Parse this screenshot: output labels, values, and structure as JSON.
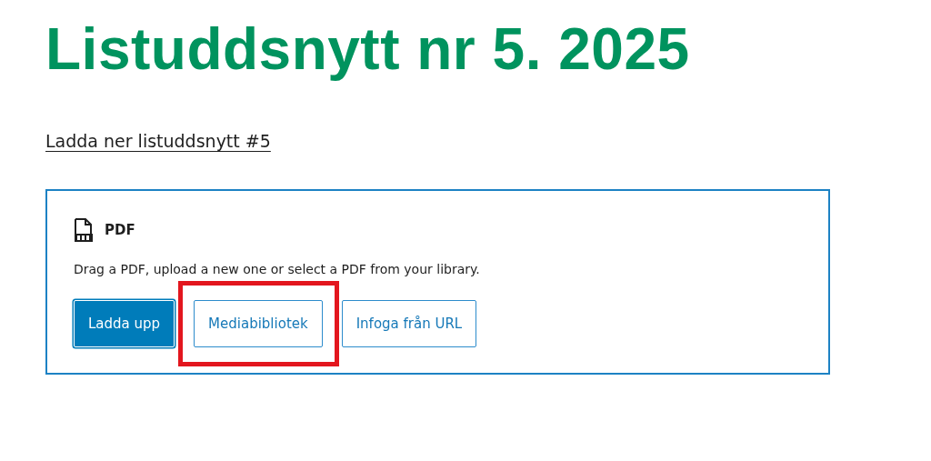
{
  "title": "Listuddsnytt nr 5. 2025",
  "download_link": "Ladda ner listuddsnytt #5",
  "pdf_block": {
    "label": "PDF",
    "instructions": "Drag a PDF, upload a new one or select a PDF from your library.",
    "buttons": [
      {
        "label": "Ladda upp",
        "kind": "primary",
        "highlighted": false
      },
      {
        "label": "Mediabibliotek",
        "kind": "secondary",
        "highlighted": true
      },
      {
        "label": "Infoga från URL",
        "kind": "secondary",
        "highlighted": false
      }
    ]
  }
}
